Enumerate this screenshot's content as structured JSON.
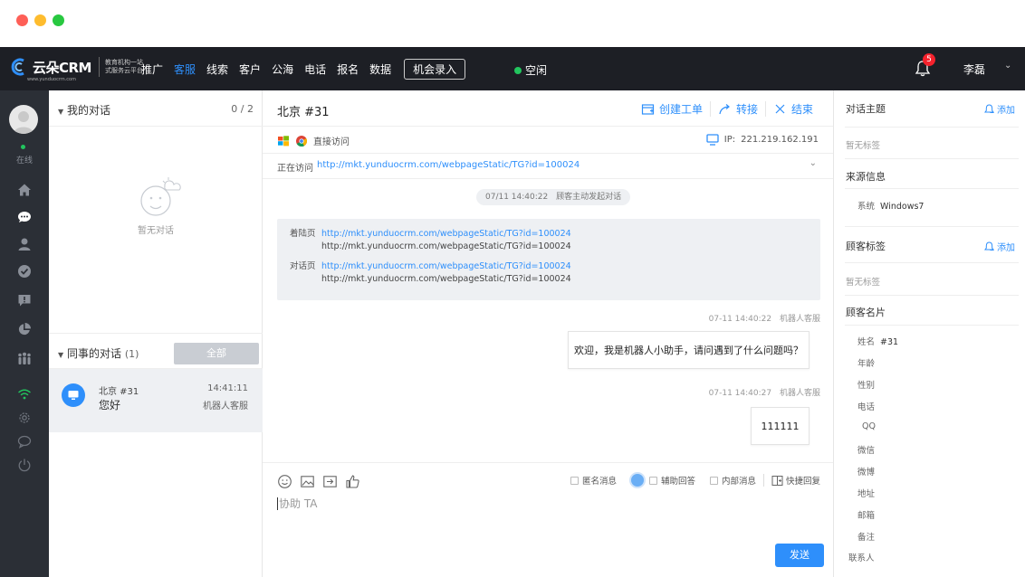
{
  "colors": {
    "accent": "#2e8ffb",
    "topbar": "#1d1f25",
    "sidebar": "#2b2f36",
    "online": "#22c55e",
    "badge": "#f5222d"
  },
  "window_buttons": [
    "close",
    "minimize",
    "zoom"
  ],
  "brand": {
    "name": "云朵CRM",
    "url": "www.yunduocrm.com",
    "slogan_line1": "教育机构一站",
    "slogan_line2": "式服务云平台"
  },
  "nav": {
    "items": [
      "推广",
      "客服",
      "线索",
      "客户",
      "公海",
      "电话",
      "报名",
      "数据"
    ],
    "active": "客服",
    "cta": "机会录入"
  },
  "status": {
    "label": "空闲"
  },
  "notifications": {
    "count": "5",
    "icon": "bell-icon"
  },
  "user": {
    "name": "李磊"
  },
  "sidebar": {
    "status": "在线",
    "icons": [
      "home-icon",
      "chat-icon",
      "user-icon",
      "check-icon",
      "message-alert-icon",
      "pie-chart-icon",
      "team-icon",
      "wifi-icon",
      "settings-icon",
      "bubble-icon",
      "power-icon"
    ]
  },
  "my_conversations": {
    "title": "我的对话",
    "count": "0 / 2",
    "empty_text": "暂无对话"
  },
  "colleague_conversations": {
    "title": "同事的对话",
    "count": "(1)",
    "filter_button": "全部",
    "items": [
      {
        "name": "北京 #31",
        "time": "14:41:11",
        "message": "您好",
        "agent": "机器人客服"
      }
    ]
  },
  "chat": {
    "title": "北京 #31",
    "actions": {
      "create_ticket": "创建工单",
      "transfer": "转接",
      "end": "结束"
    },
    "source": "直接访问",
    "ip_label": "IP:",
    "ip": "221.219.162.191",
    "visiting_label": "正在访问",
    "visiting_url": "http://mkt.yunduocrm.com/webpageStatic/TG?id=100024",
    "system_notice": {
      "time": "07/11 14:40:22",
      "text": "顾客主动发起对话"
    },
    "landing_label": "着陆页",
    "landing_url": "http://mkt.yunduocrm.com/webpageStatic/TG?id=100024",
    "landing_url_2": "http://mkt.yunduocrm.com/webpageStatic/TG?id=100024",
    "dialog_label": "对话页",
    "dialog_url": "http://mkt.yunduocrm.com/webpageStatic/TG?id=100024",
    "dialog_url_2": "http://mkt.yunduocrm.com/webpageStatic/TG?id=100024",
    "messages": [
      {
        "time": "07-11 14:40:22",
        "sender": "机器人客服",
        "text": "欢迎，我是机器人小助手，请问遇到了什么问题吗？"
      },
      {
        "time": "07-11 14:40:27",
        "sender": "机器人客服",
        "text": "111111"
      }
    ],
    "composer": {
      "tools": [
        "smile-icon",
        "image-icon",
        "export-icon",
        "thumb-icon"
      ],
      "option_anonymous": "匿名消息",
      "option_assist": "辅助回答",
      "option_internal": "内部消息",
      "quick_reply": "快捷回复",
      "placeholder": "协助 TA",
      "send": "发送"
    }
  },
  "right_panel": {
    "topic": {
      "title": "对话主题",
      "add": "添加",
      "empty": "暂无标签"
    },
    "source": {
      "title": "来源信息",
      "system_label": "系统",
      "system_value": "Windows7"
    },
    "tags": {
      "title": "顾客标签",
      "add": "添加",
      "empty": "暂无标签"
    },
    "card": {
      "title": "顾客名片",
      "name_label": "姓名",
      "name_value": "#31",
      "fields": [
        "年龄",
        "性别",
        "电话",
        "QQ",
        "微信",
        "微博",
        "地址",
        "邮箱",
        "备注"
      ],
      "contact": "联系人"
    }
  }
}
